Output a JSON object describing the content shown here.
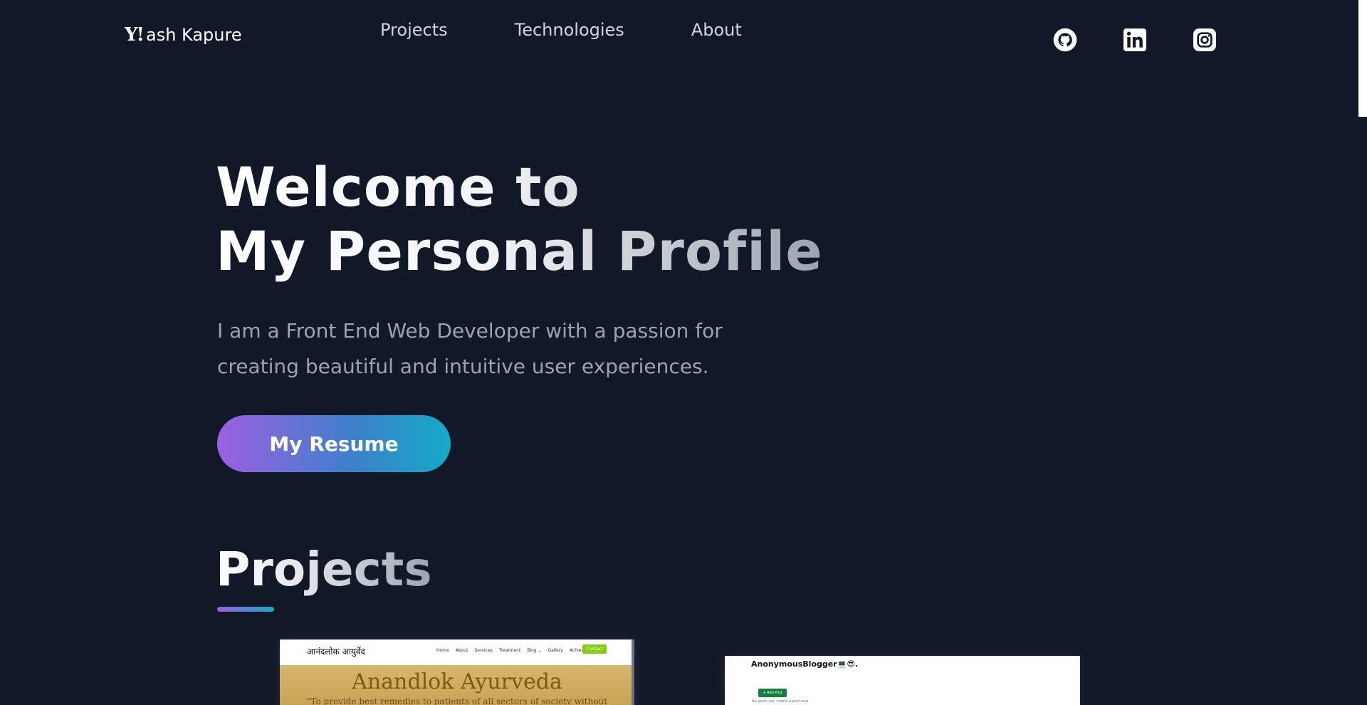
{
  "header": {
    "brand_mark": "Y!",
    "brand_name": "ash Kapure",
    "nav": [
      "Projects",
      "Technologies",
      "About"
    ],
    "social": [
      "github-icon",
      "linkedin-icon",
      "instagram-icon"
    ]
  },
  "hero": {
    "title_line1": "Welcome to",
    "title_line2": "My Personal Profile",
    "subtitle_line1": "I am a Front End Web Developer with a passion for",
    "subtitle_line2": "creating beautiful and intuitive user experiences.",
    "resume_label": "My Resume"
  },
  "projects": {
    "heading": "Projects",
    "cards": [
      {
        "logo": "आनंदलोक आयुर्वेद",
        "nav": [
          "Home",
          "About",
          "Services",
          "Treatment",
          "Blog ⌄",
          "Gallery",
          "Achievements"
        ],
        "contact": "Contact",
        "title": "Anandlok Ayurveda",
        "tagline": "\"To provide best remedies to patients of all sectors of society without"
      },
      {
        "title": "AnonymousBlogger💻😎.",
        "button": "+ Add Post",
        "note": "No posts yet, create a post now"
      }
    ]
  },
  "colors": {
    "background": "#111827",
    "accent_start": "#9c5fe3",
    "accent_end": "#14aac8",
    "text_muted": "#9ca3af"
  }
}
